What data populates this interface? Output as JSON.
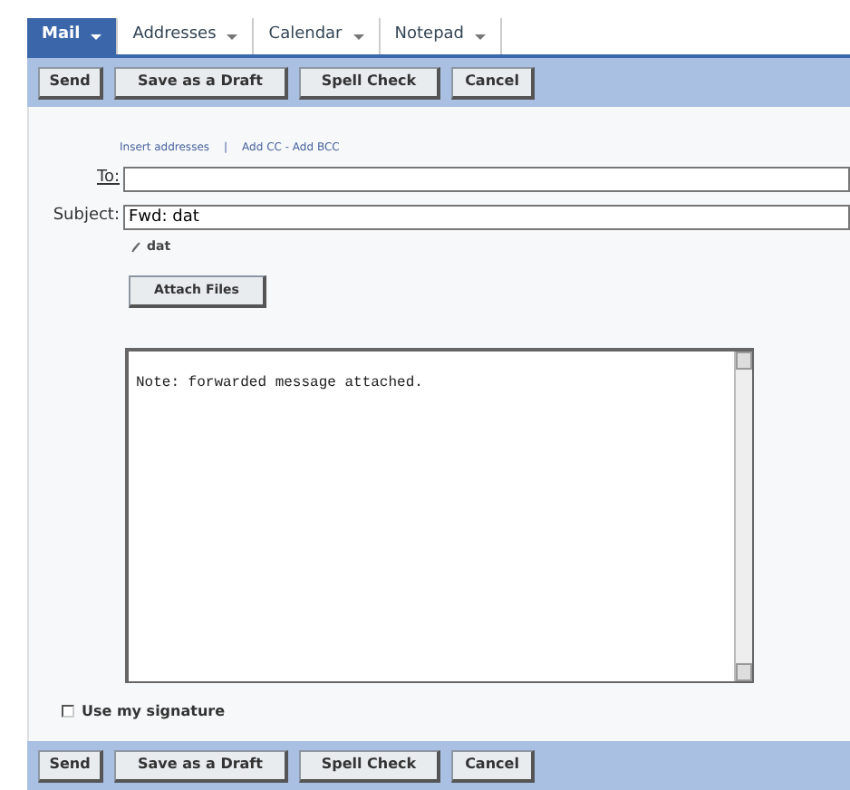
{
  "tabs": [
    {
      "label": "Mail",
      "selected": true
    },
    {
      "label": "Addresses",
      "selected": false
    },
    {
      "label": "Calendar",
      "selected": false
    },
    {
      "label": "Notepad",
      "selected": false
    }
  ],
  "top_toolbar": [
    "Send",
    "Save as a Draft",
    "Spell Check",
    "Cancel"
  ],
  "address_links": [
    "Insert addresses",
    "|",
    "Add CC - Add BCC"
  ],
  "to": {
    "label": "To:"
  },
  "subject": {
    "label": "Subject:",
    "value": "Fwd: dat"
  },
  "attachment": "dat",
  "attach_button": "Attach Files",
  "body": "Note: forwarded message attached.",
  "signature": {
    "label": "Use my signature",
    "checked": false
  },
  "bottom_toolbar": [
    "Send",
    "Save as a Draft",
    "Spell Check",
    "Cancel"
  ]
}
